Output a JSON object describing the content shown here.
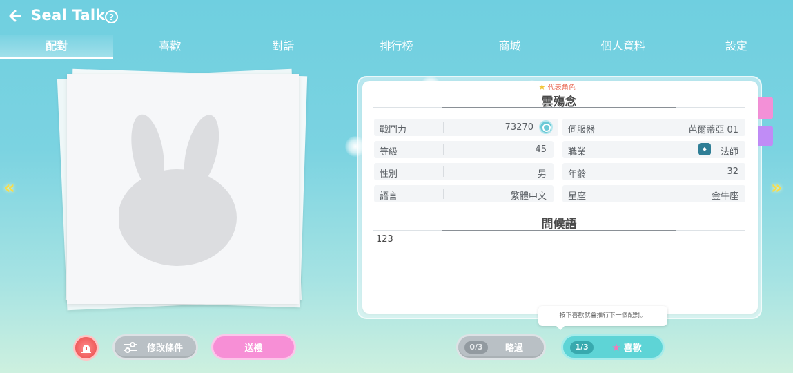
{
  "header": {
    "title": "Seal Talk",
    "help": "?"
  },
  "tabs": [
    "配對",
    "喜歡",
    "對話",
    "排行榜",
    "商城",
    "個人資料",
    "設定"
  ],
  "active_tab": 0,
  "profile": {
    "rep_badge": "代表角色",
    "name": "雲殤念",
    "stats": {
      "power_label": "戰鬥力",
      "power_value": "73270",
      "server_label": "伺服器",
      "server_value": "芭爾蒂亞 01",
      "level_label": "等級",
      "level_value": "45",
      "job_label": "職業",
      "job_value": "法師",
      "gender_label": "性別",
      "gender_value": "男",
      "age_label": "年齡",
      "age_value": "32",
      "lang_label": "語言",
      "lang_value": "繁體中文",
      "zodiac_label": "星座",
      "zodiac_value": "金牛座"
    },
    "greeting_title": "問候語",
    "greeting_text": "123"
  },
  "tooltip": "按下喜歡就會推行下一個配對。",
  "bottom": {
    "filter_label": "修改條件",
    "gift_label": "送禮",
    "skip_count": "0/3",
    "skip_label": "略過",
    "like_count": "1/3",
    "like_label": "喜歡"
  },
  "nav": {
    "left": "«",
    "right": "»"
  },
  "colors": {
    "accent_teal": "#5ed4d6",
    "accent_pink": "#f78fd6",
    "alarm_red": "#ef5d5d",
    "star_yellow": "#f6dc4a"
  },
  "icons": [
    "back-arrow-icon",
    "help-icon",
    "search-icon",
    "mage-class-icon",
    "alarm-icon",
    "filter-icon",
    "star-icon",
    "bunny-placeholder-icon"
  ]
}
